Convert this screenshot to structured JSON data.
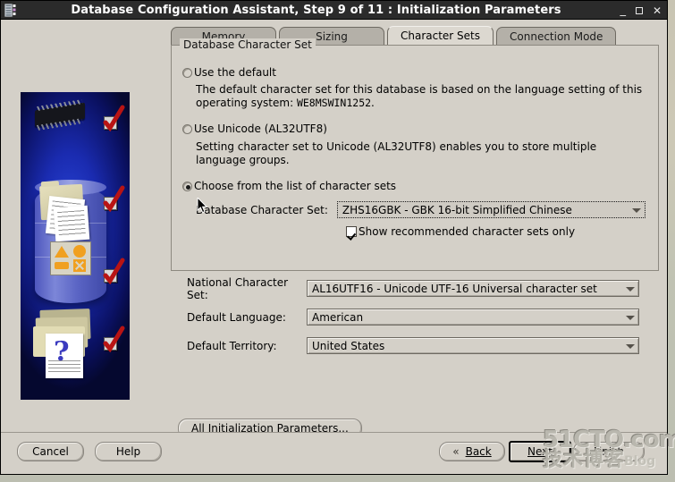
{
  "window": {
    "title": "Database Configuration Assistant, Step 9 of 11 : Initialization Parameters",
    "icon": "database-window-icon",
    "minimize_label": "_",
    "maximize_label": "□",
    "close_label": "✕"
  },
  "tabs": [
    {
      "label": "Memory",
      "active": false
    },
    {
      "label": "Sizing",
      "active": false
    },
    {
      "label": "Character Sets",
      "active": true
    },
    {
      "label": "Connection Mode",
      "active": false
    }
  ],
  "group": {
    "legend": "Database Character Set",
    "options": [
      {
        "id": "use-default",
        "label": "Use the default",
        "selected": false,
        "help_prefix": "The default character set for this database is based on the language setting of this operating system: ",
        "help_value": "WE8MSWIN1252",
        "help_suffix": "."
      },
      {
        "id": "use-unicode",
        "label": "Use Unicode (AL32UTF8)",
        "selected": false,
        "help": "Setting character set to Unicode (AL32UTF8) enables you to store multiple language groups."
      },
      {
        "id": "choose-from-list",
        "label": "Choose from the list of character sets",
        "selected": true
      }
    ],
    "db_charset_label": "Database Character Set:",
    "db_charset_value": "ZHS16GBK - GBK 16-bit Simplified Chinese",
    "show_recommended_label": "Show recommended character sets only",
    "show_recommended_checked": true
  },
  "lower_fields": [
    {
      "label": "National Character Set:",
      "value": "AL16UTF16 - Unicode UTF-16 Universal character set"
    },
    {
      "label": "Default Language:",
      "value": "American"
    },
    {
      "label": "Default Territory:",
      "value": "United States"
    }
  ],
  "all_params_button": "All Initialization Parameters...",
  "footer": {
    "cancel": "Cancel",
    "help": "Help",
    "back": "Back",
    "back_icon": "chevron-left-icon",
    "next": "Next",
    "next_icon": "chevron-right-icon",
    "finish": "Finish"
  },
  "watermark": {
    "line1": "51CTO.com",
    "line2": "技术博客",
    "line3": "Blog"
  },
  "colors": {
    "window_face": "#d4d0c8",
    "titlebar": "#2b2b2b",
    "title_text": "#ffffff",
    "tab_inactive": "#b4b0a8",
    "tab_active": "#dcd8d0",
    "illustration_blue": "#1a2bb0",
    "checkmark_red": "#b81414",
    "shape_orange": "#f0a020"
  }
}
